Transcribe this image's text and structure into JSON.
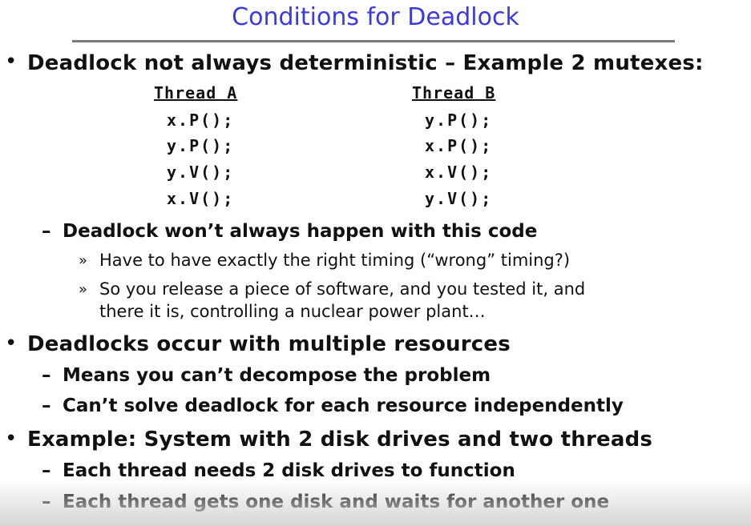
{
  "slide": {
    "title": "Conditions for Deadlock",
    "bullets": [
      {
        "marker": "•",
        "text": "Deadlock not always deterministic – Example 2 mutexes:",
        "code": {
          "thread_a": {
            "header": "Thread A",
            "lines": [
              "x.P();",
              "y.P();",
              "y.V();",
              "x.V();"
            ]
          },
          "thread_b": {
            "header": "Thread B",
            "lines": [
              "y.P();",
              "x.P();",
              "x.V();",
              "y.V();"
            ]
          }
        },
        "subitems": [
          {
            "marker": "–",
            "text": "Deadlock won’t always happen with this code",
            "subsubitems": [
              {
                "marker": "»",
                "text": "Have to have exactly the right timing (“wrong” timing?)"
              },
              {
                "marker": "»",
                "text_line1": "So you release a piece of software, and you tested it, and",
                "text_line2": "there it is, controlling a nuclear power plant…"
              }
            ]
          }
        ]
      },
      {
        "marker": "•",
        "text": "Deadlocks occur with multiple resources",
        "subitems": [
          {
            "marker": "–",
            "text": "Means you can’t decompose the problem"
          },
          {
            "marker": "–",
            "text": "Can’t solve deadlock for each resource independently"
          }
        ]
      },
      {
        "marker": "•",
        "text": "Example: System with 2 disk drives and two threads",
        "subitems": [
          {
            "marker": "–",
            "text": "Each thread needs 2 disk drives to function"
          },
          {
            "marker": "–",
            "text": "Each thread gets one disk and waits for another one"
          }
        ]
      }
    ]
  },
  "colors": {
    "title": "#3a3ae0",
    "rule": "#7a7a7a",
    "text": "#111111"
  }
}
